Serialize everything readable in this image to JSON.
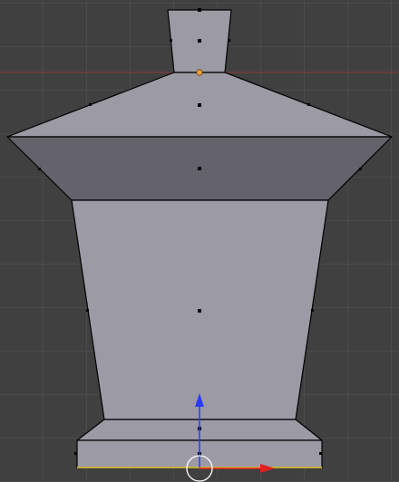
{
  "viewport": {
    "view": "front",
    "grid": true,
    "background_color": "#404040",
    "grid_color": "#4b4b4b",
    "x_axis_color": "#8a3a3a"
  },
  "mesh": {
    "face_color_light": "#9b9aa5",
    "face_color_dark": "#64636c",
    "edge_color": "#000000",
    "selected_vertex_color": "#f5a03c"
  },
  "gizmo": {
    "x_arrow_color": "#e0201f",
    "y_arrow_color": "#2a3bff",
    "cursor_ring_color": "#ffffff",
    "active_edge_color": "#e8c92a"
  }
}
